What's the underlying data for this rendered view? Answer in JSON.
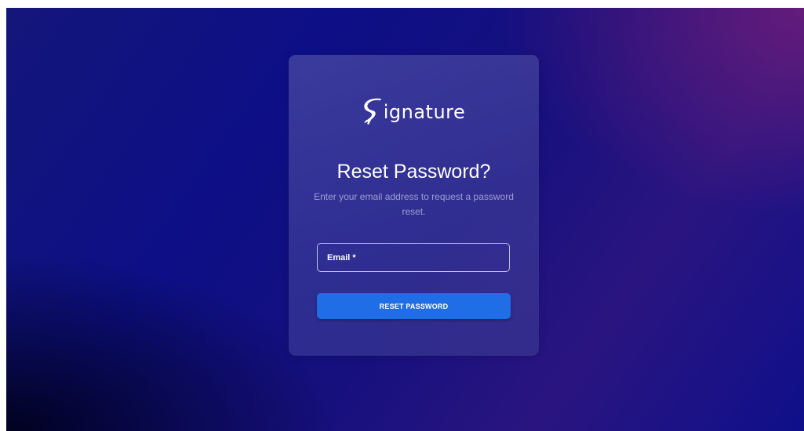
{
  "brand": {
    "name": "ignature",
    "logo_icon": "signature-s-logo-icon",
    "color": "#ffffff"
  },
  "reset_form": {
    "title": "Reset Password?",
    "subtitle": "Enter your email address to request a password reset.",
    "email_field": {
      "label": "Email *",
      "value": ""
    },
    "submit_label": "RESET PASSWORD"
  },
  "colors": {
    "button": "#1f6ee6",
    "background_primary": "#0d0f86",
    "background_accent": "#781e78"
  }
}
